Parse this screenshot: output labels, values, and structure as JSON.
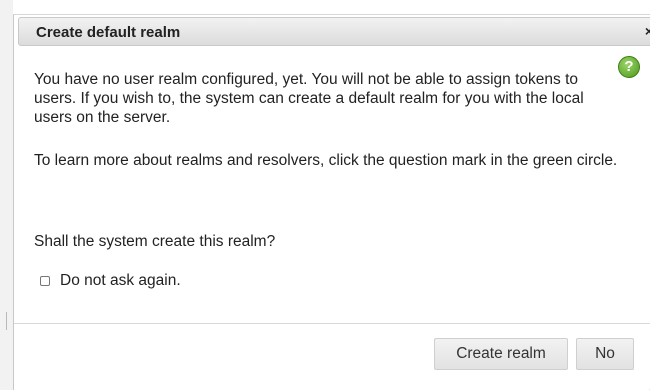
{
  "dialog": {
    "title": "Create default realm",
    "close_glyph": "×",
    "help_glyph": "?",
    "paragraph_1": "You have no user realm configured, yet. You will not be able to assign tokens to users. If you wish to, the system can create a default realm for you with the local users on the server.",
    "paragraph_2": "To learn more about realms and resolvers, click the question mark in the green circle.",
    "question": "Shall the system create this realm?",
    "checkbox_label": "Do not ask again.",
    "checkbox_checked": false,
    "buttons": {
      "create": "Create realm",
      "no": "No"
    }
  },
  "colors": {
    "help_green": "#6bb52f",
    "titlebar": "#e4e4e4",
    "button": "#e8e8e8"
  },
  "icons": [
    "close-icon",
    "help-icon",
    "resize-handle-icon"
  ]
}
